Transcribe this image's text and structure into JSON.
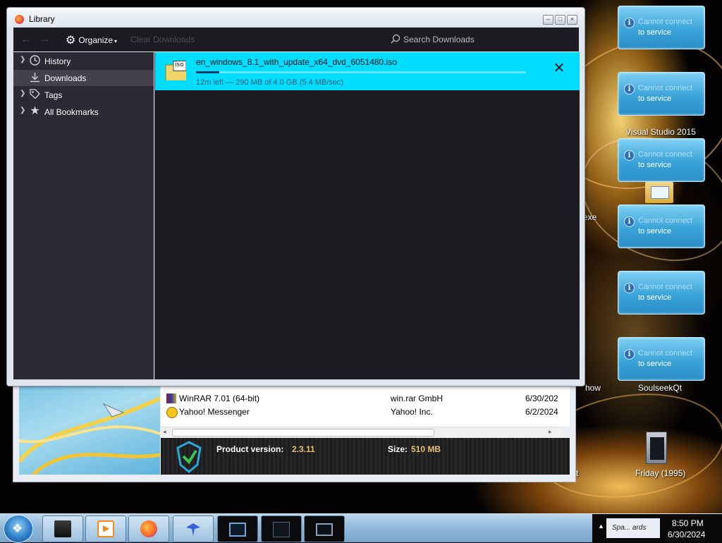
{
  "library": {
    "title": "Library",
    "toolbar": {
      "organize_label": "Organize",
      "clear_label": "Clear Downloads",
      "search_placeholder": "Search Downloads"
    },
    "sidebar": [
      {
        "label": "History",
        "icon": "clock-icon",
        "selected": false
      },
      {
        "label": "Downloads",
        "icon": "download-icon",
        "selected": true
      },
      {
        "label": "Tags",
        "icon": "tag-icon",
        "selected": false
      },
      {
        "label": "All Bookmarks",
        "icon": "star-icon",
        "selected": false
      }
    ],
    "download": {
      "filename": "en_windows_8.1_with_update_x64_dvd_6051480.iso",
      "file_badge": "iso",
      "status": "12m left — 290 MB of 4.0 GB (5.4 MB/sec)",
      "progress": 0.07
    }
  },
  "programs": {
    "rows": [
      {
        "name": "WinRAR 7.01 (64-bit)",
        "publisher": "win.rar GmbH",
        "date": "6/30/202"
      },
      {
        "name": "Yahoo! Messenger",
        "publisher": "Yahoo! Inc.",
        "date": "6/2/2024"
      }
    ],
    "product_version_label": "Product version:",
    "product_version": "2.3.11",
    "size_label": "Size:",
    "size": "510 MB"
  },
  "desktop": {
    "notifications": [
      {
        "line1": "Cannot connect",
        "line2": "to service"
      },
      {
        "line1": "Cannot connect",
        "line2": "to service"
      },
      {
        "line1": "Cannot connect",
        "line2": "to service"
      },
      {
        "line1": "Cannot connect",
        "line2": "to service"
      },
      {
        "line1": "Cannot connect",
        "line2": "to service"
      },
      {
        "line1": "Cannot connect",
        "line2": "to service"
      }
    ],
    "icons": {
      "visual_studio": "Visual Studio 2015",
      "soulseek": "SoulseekQt",
      "friday": "Friday (1995)",
      "exe_fragment": "exe",
      "how_fragment": "how",
      "t_fragment": "t"
    }
  },
  "taskbar": {
    "time": "8:50 PM",
    "date": "6/30/2024",
    "tray_fragment": "Spa... ards"
  },
  "colors": {
    "download_highlight": "#00ddff",
    "dark_bg": "#1c1b22",
    "sidebar_bg": "#2b2a33",
    "product_accent": "#e8c070"
  }
}
